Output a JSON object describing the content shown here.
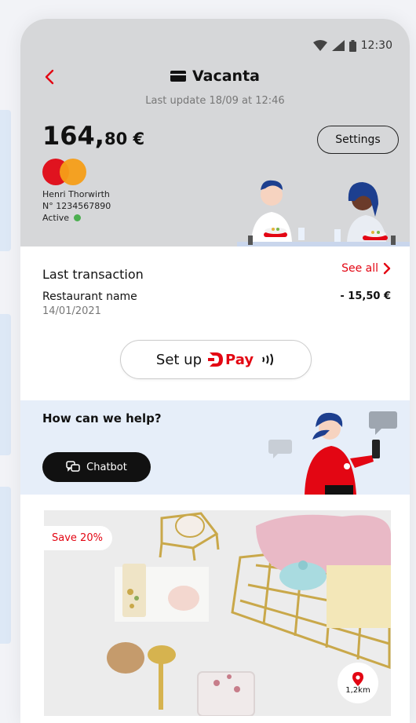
{
  "status_bar": {
    "time": "12:30"
  },
  "header": {
    "title": "Vacanta",
    "last_update": "Last update 18/09 at 12:46",
    "balance_int": "164,",
    "balance_dec": "80 €",
    "settings_label": "Settings"
  },
  "card": {
    "holder_name": "Henri Thorwirth",
    "number": "N° 1234567890",
    "status": "Active"
  },
  "transaction": {
    "section_title": "Last transaction",
    "see_all_label": "See all",
    "name": "Restaurant name",
    "date": "14/01/2021",
    "amount": "- 15,50 €"
  },
  "setup": {
    "label": "Set up",
    "pay_label": "Pay"
  },
  "help": {
    "title": "How can we help?",
    "chatbot_label": "Chatbot"
  },
  "offer": {
    "badge": "Save 20%",
    "distance": "1,2km"
  },
  "colors": {
    "accent": "#e30613",
    "hero_bg": "#d6d7d9",
    "help_bg": "#e6eef9",
    "active": "#4caf50"
  }
}
